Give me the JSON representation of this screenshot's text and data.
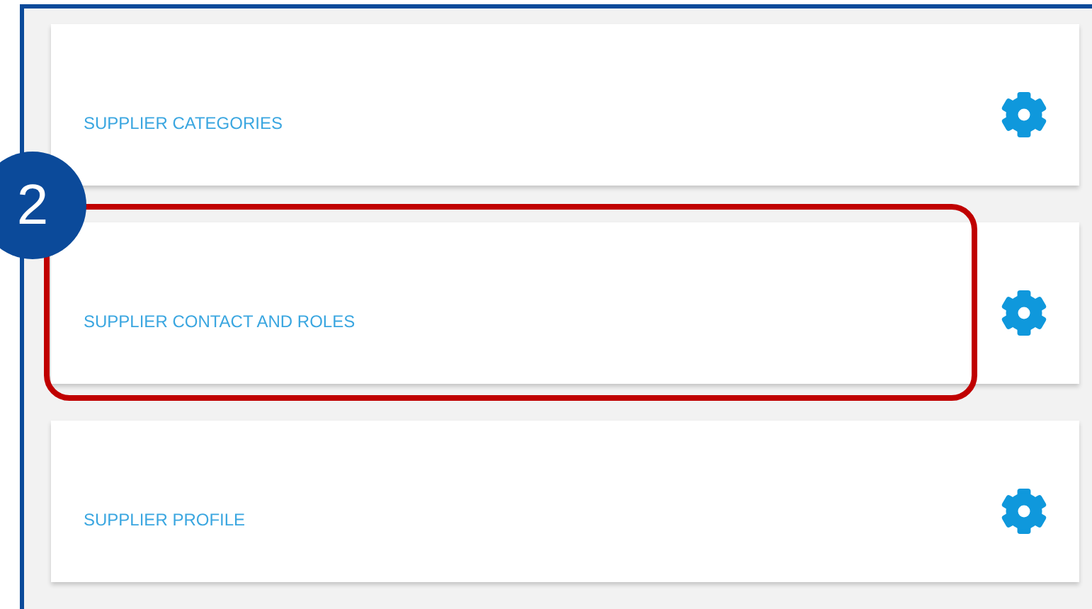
{
  "cards": [
    {
      "label": "SUPPLIER CATEGORIES",
      "highlighted": false
    },
    {
      "label": "SUPPLIER CONTACT AND ROLES",
      "highlighted": true
    },
    {
      "label": "SUPPLIER PROFILE",
      "highlighted": false
    }
  ],
  "callout": {
    "step": "2"
  }
}
